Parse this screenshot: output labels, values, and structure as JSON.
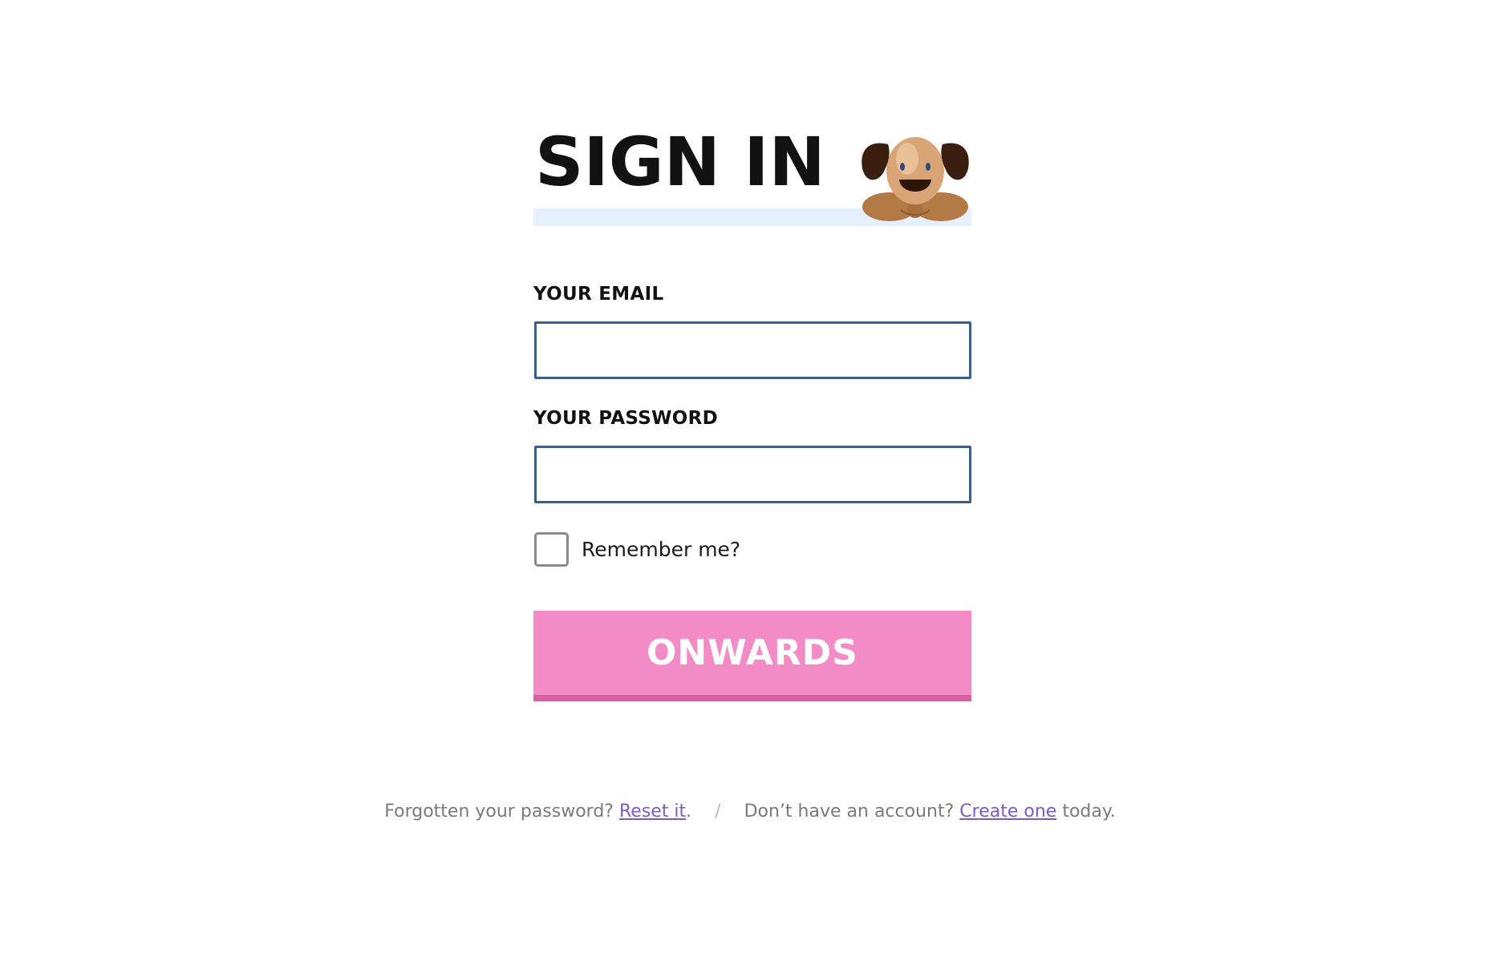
{
  "title": "SIGN IN",
  "mascot_icon": "puppy-mascot-icon",
  "form": {
    "email_label": "YOUR EMAIL",
    "email_value": "",
    "password_label": "YOUR PASSWORD",
    "password_value": "",
    "remember_label": "Remember me?",
    "remember_checked": false,
    "submit_label": "ONWARDS"
  },
  "footer": {
    "forgot_prefix": "Forgotten your password?",
    "reset_link": "Reset it",
    "reset_suffix": ".",
    "separator": "/",
    "account_prefix": "Don’t have an account?",
    "create_link": "Create one",
    "create_suffix": "today."
  },
  "colors": {
    "title_underline": "#e6effc",
    "input_border": "#3c5f89",
    "button_bg": "#f28bc6",
    "button_shadow": "#d3629f",
    "link": "#7c5cc4"
  }
}
